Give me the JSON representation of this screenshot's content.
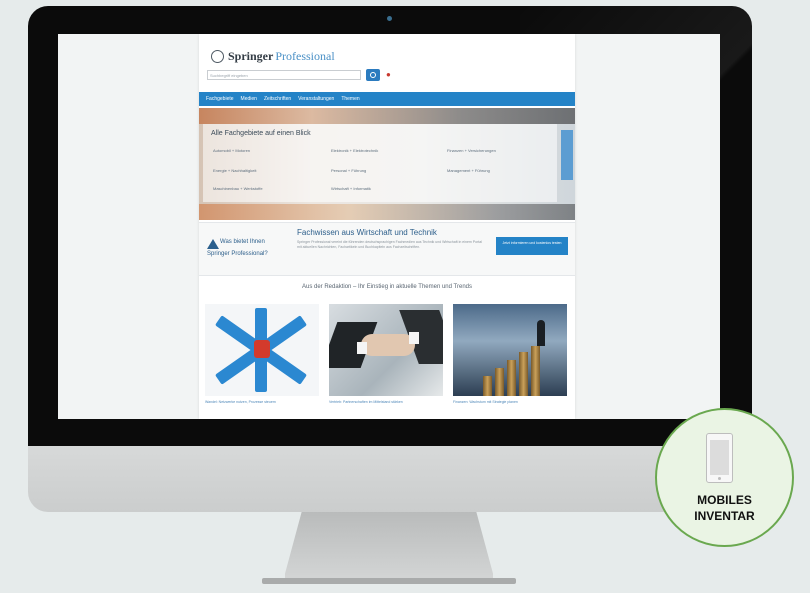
{
  "site": {
    "logo_brand": "Springer",
    "logo_sub": "Professional",
    "search_placeholder": "Suchbegriff eingeben",
    "nav_items": [
      "Fachgebiete",
      "Medien",
      "Zeitschriften",
      "Veranstaltungen",
      "Themen"
    ],
    "hero_title": "Alle Fachgebiete auf einen Blick",
    "hero_links": [
      [
        "Automobil + Motoren",
        "Elektronik + Elektrotechnik",
        "Finanzen + Versicherungen"
      ],
      [
        "Energie + Nachhaltigkeit",
        "Personal + Führung",
        "Management + Führung"
      ],
      [
        "Maschinenbau + Werkstoffe",
        "Wirtschaft + Informatik",
        ""
      ]
    ],
    "promo_question_line1": "Was bietet Ihnen",
    "promo_question_line2": "Springer Professional?",
    "promo_title": "Fachwissen aus Wirtschaft und Technik",
    "promo_body": "Springer Professional vereint die führenden deutschsprachigen Fachmedien aus Technik und Wirtschaft in einem Portal mit aktuellen Nachrichten, Fachartikeln und Buchkapiteln aus Fachzeitschriften.",
    "promo_cta": "Jetzt informieren und kostenlos testen",
    "editorial_heading": "Aus der Redaktion – Ihr Einstieg in aktuelle Themen und Trends",
    "editorial_captions": [
      "Wandel: Netzwerke nutzen, Prozesse steuern",
      "Vertrieb: Partnerschaften im Mittelstand stärken",
      "Finanzen: Wachstum mit Strategie planen"
    ]
  },
  "badge": {
    "line1": "MOBILES",
    "line2": "INVENTAR",
    "icon": "smartphone-icon",
    "color": "#6aa84f"
  }
}
